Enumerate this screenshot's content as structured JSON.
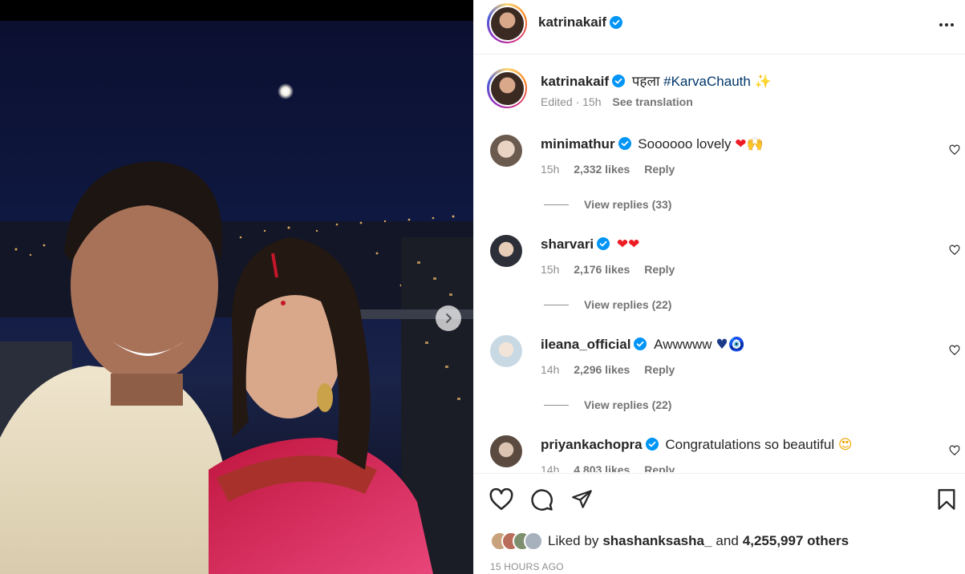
{
  "post": {
    "author": "katrinakaif",
    "more_icon": "more-horizontal-icon"
  },
  "caption": {
    "username": "katrinakaif",
    "text": "पहला",
    "hashtag": "#KarvaChauth",
    "emoji": "✨",
    "edited": "Edited · 15h",
    "see_translation": "See translation"
  },
  "comments": [
    {
      "username": "minimathur",
      "text": "Soooooo lovely",
      "emoji": "❤🙌",
      "time": "15h",
      "likes": "2,332 likes",
      "reply": "Reply",
      "view_replies": "View replies (33)",
      "avatar_color": "#cdbfb3"
    },
    {
      "username": "sharvari",
      "text": "",
      "emoji": "❤❤",
      "time": "15h",
      "likes": "2,176 likes",
      "reply": "Reply",
      "view_replies": "View replies (22)",
      "avatar_color": "#3a3f4a"
    },
    {
      "username": "ileana_official",
      "text": "Awwwww",
      "emoji": "♥🧿",
      "time": "14h",
      "likes": "2,296 likes",
      "reply": "Reply",
      "view_replies": "View replies (22)",
      "avatar_color": "#dfe8ee"
    },
    {
      "username": "priyankachopra",
      "text": "Congratulations so beautiful",
      "emoji": "😍",
      "time": "14h",
      "likes": "4,803 likes",
      "reply": "Reply",
      "view_replies": "",
      "avatar_color": "#b8b2ab"
    }
  ],
  "actions": {
    "like_icon": "heart-icon",
    "comment_icon": "comment-icon",
    "share_icon": "send-icon",
    "save_icon": "bookmark-icon"
  },
  "likes": {
    "prefix": "Liked by",
    "user": "shashanksasha_",
    "and": "and",
    "count": "4,255,997 others"
  },
  "timestamp": "15 HOURS AGO",
  "colors": {
    "verified": "#0095f6",
    "heart_red": "#ed1c24",
    "hashtag": "#00376b",
    "muted": "#8e8e8e"
  }
}
